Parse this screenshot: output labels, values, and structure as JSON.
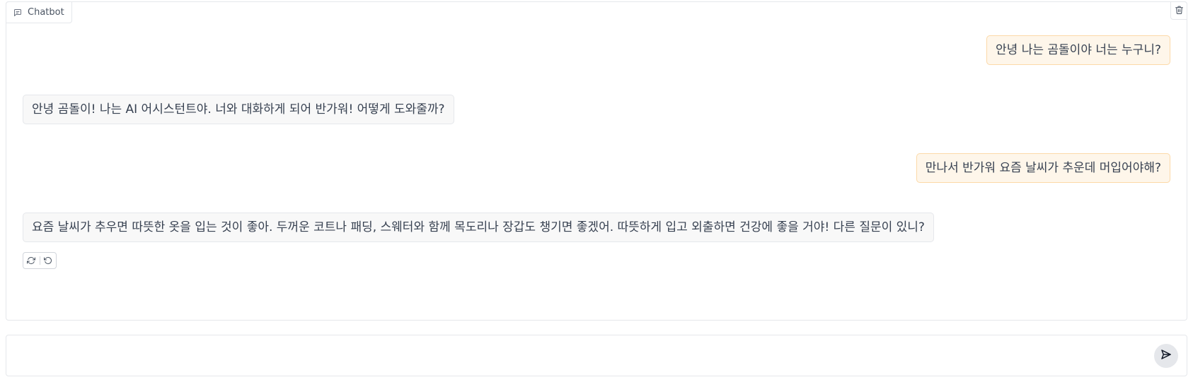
{
  "chatbot": {
    "label": "Chatbot",
    "label_icon": "chat-bubble-icon",
    "clear_icon": "trash-icon",
    "messages": [
      {
        "role": "user",
        "text": "안녕 나는 곰돌이야 너는 누구니?"
      },
      {
        "role": "bot",
        "text": "안녕 곰돌이! 나는 AI 어시스턴트야. 너와 대화하게 되어 반가워! 어떻게 도와줄까?"
      },
      {
        "role": "user",
        "text": "만나서 반가워 요즘 날씨가 추운데 머입어야해?"
      },
      {
        "role": "bot",
        "text": "요즘 날씨가 추우면 따뜻한 옷을 입는 것이 좋아. 두꺼운 코트나 패딩, 스웨터와 함께 목도리나 장갑도 챙기면 좋겠어. 따뜻하게 입고 외출하면 건강에 좋을 거야! 다른 질문이 있니?"
      }
    ],
    "actions": [
      {
        "name": "retry",
        "icon": "refresh-icon"
      },
      {
        "name": "undo",
        "icon": "undo-icon"
      }
    ]
  },
  "input": {
    "value": "",
    "placeholder": "",
    "send_icon": "send-icon"
  },
  "colors": {
    "user_bubble_bg": "#fef6ea",
    "user_bubble_border": "#fcd9a8",
    "bot_bubble_bg": "#f8f8f8",
    "border": "#e5e7eb"
  }
}
